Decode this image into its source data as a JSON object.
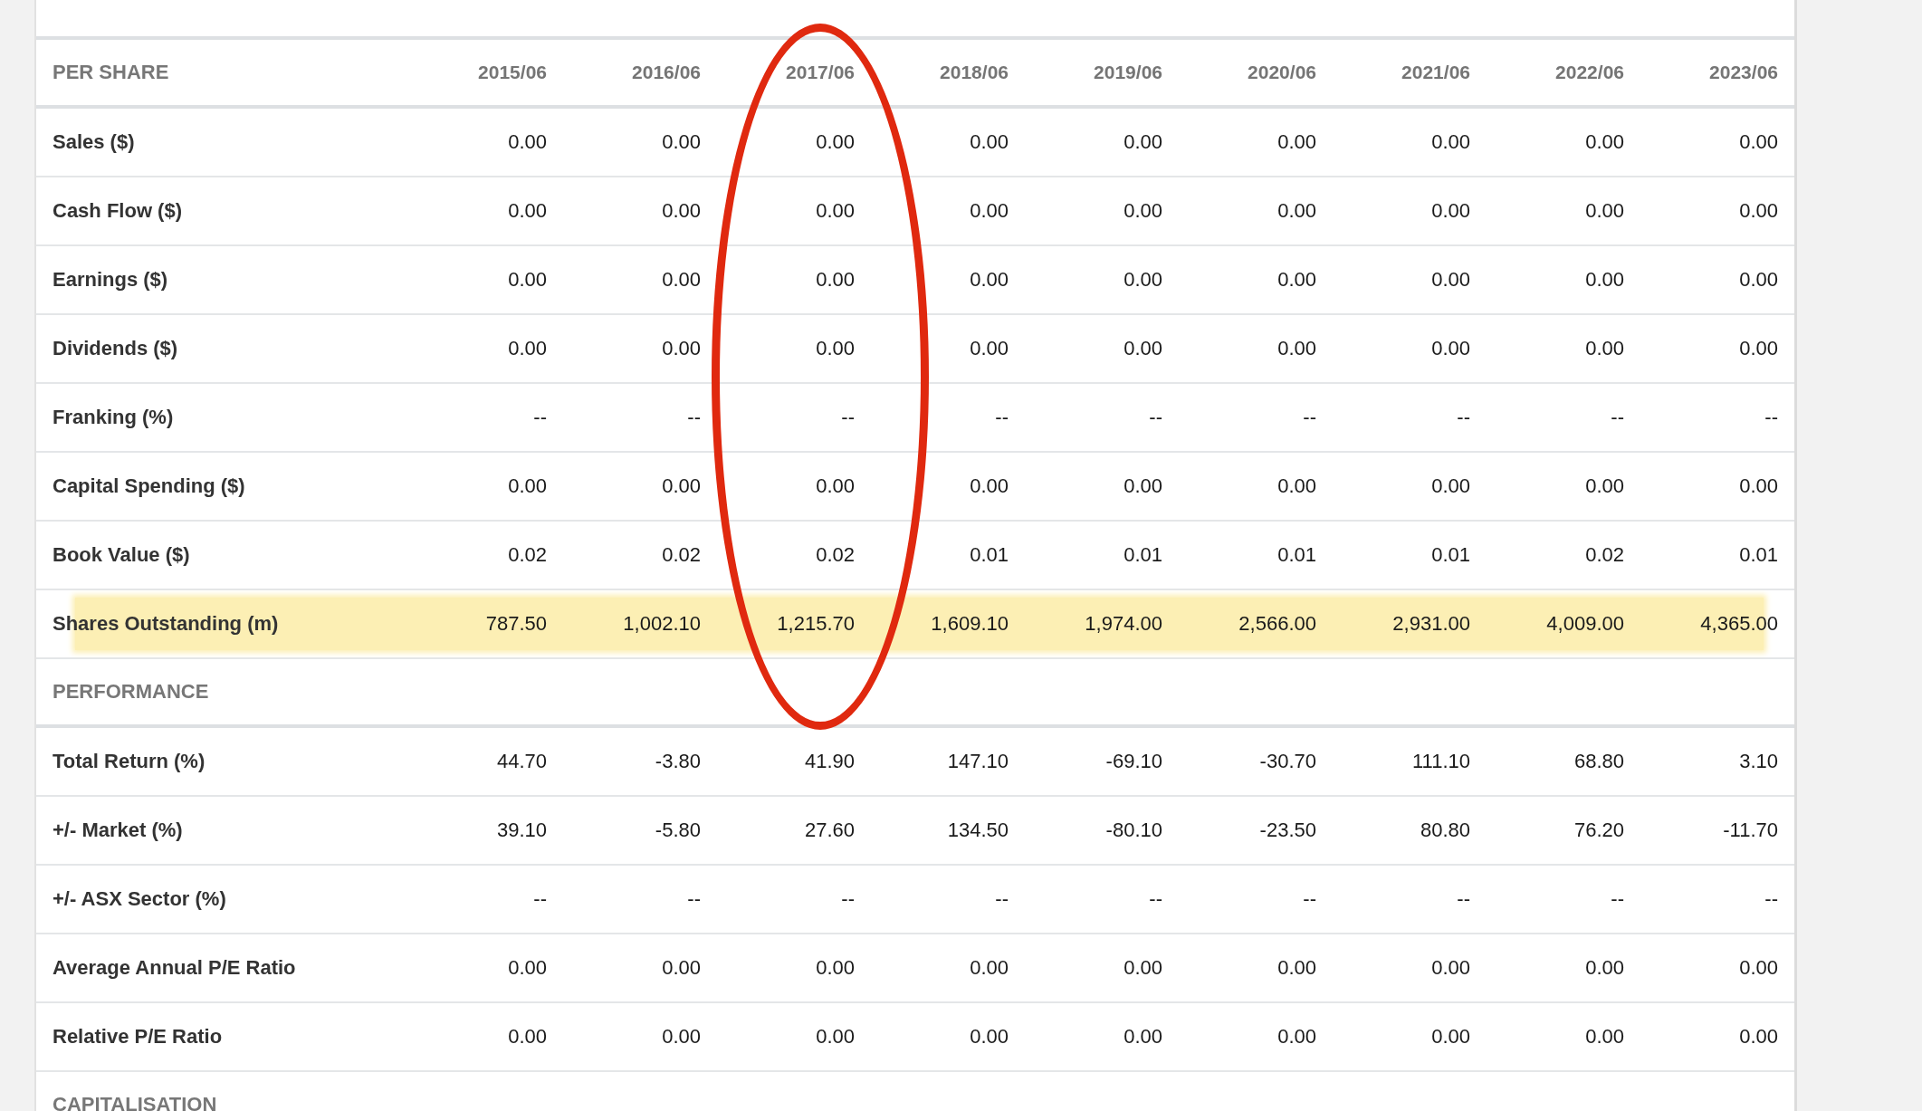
{
  "columns": [
    {
      "label": "2015/06",
      "circled": false
    },
    {
      "label": "2016/06",
      "circled": false
    },
    {
      "label": "2017/06",
      "circled": true
    },
    {
      "label": "2018/06",
      "circled": false
    },
    {
      "label": "2019/06",
      "circled": false
    },
    {
      "label": "2020/06",
      "circled": false
    },
    {
      "label": "2021/06",
      "circled": false
    },
    {
      "label": "2022/06",
      "circled": false
    },
    {
      "label": "2023/06",
      "circled": false
    }
  ],
  "sections": [
    {
      "title": "PER SHARE",
      "rows": [
        {
          "label": "Sales ($)",
          "highlighted": false,
          "values": [
            "0.00",
            "0.00",
            "0.00",
            "0.00",
            "0.00",
            "0.00",
            "0.00",
            "0.00",
            "0.00"
          ]
        },
        {
          "label": "Cash Flow ($)",
          "highlighted": false,
          "values": [
            "0.00",
            "0.00",
            "0.00",
            "0.00",
            "0.00",
            "0.00",
            "0.00",
            "0.00",
            "0.00"
          ]
        },
        {
          "label": "Earnings ($)",
          "highlighted": false,
          "values": [
            "0.00",
            "0.00",
            "0.00",
            "0.00",
            "0.00",
            "0.00",
            "0.00",
            "0.00",
            "0.00"
          ]
        },
        {
          "label": "Dividends ($)",
          "highlighted": false,
          "values": [
            "0.00",
            "0.00",
            "0.00",
            "0.00",
            "0.00",
            "0.00",
            "0.00",
            "0.00",
            "0.00"
          ]
        },
        {
          "label": "Franking (%)",
          "highlighted": false,
          "values": [
            "--",
            "--",
            "--",
            "--",
            "--",
            "--",
            "--",
            "--",
            "--"
          ]
        },
        {
          "label": "Capital Spending ($)",
          "highlighted": false,
          "values": [
            "0.00",
            "0.00",
            "0.00",
            "0.00",
            "0.00",
            "0.00",
            "0.00",
            "0.00",
            "0.00"
          ]
        },
        {
          "label": "Book Value ($)",
          "highlighted": false,
          "values": [
            "0.02",
            "0.02",
            "0.02",
            "0.01",
            "0.01",
            "0.01",
            "0.01",
            "0.02",
            "0.01"
          ]
        },
        {
          "label": "Shares Outstanding (m)",
          "highlighted": true,
          "values": [
            "787.50",
            "1,002.10",
            "1,215.70",
            "1,609.10",
            "1,974.00",
            "2,566.00",
            "2,931.00",
            "4,009.00",
            "4,365.00"
          ]
        }
      ]
    },
    {
      "title": "PERFORMANCE",
      "rows": [
        {
          "label": "Total Return (%)",
          "highlighted": false,
          "values": [
            "44.70",
            "-3.80",
            "41.90",
            "147.10",
            "-69.10",
            "-30.70",
            "111.10",
            "68.80",
            "3.10"
          ]
        },
        {
          "label": "+/- Market (%)",
          "highlighted": false,
          "values": [
            "39.10",
            "-5.80",
            "27.60",
            "134.50",
            "-80.10",
            "-23.50",
            "80.80",
            "76.20",
            "-11.70"
          ]
        },
        {
          "label": "+/- ASX Sector (%)",
          "highlighted": false,
          "values": [
            "--",
            "--",
            "--",
            "--",
            "--",
            "--",
            "--",
            "--",
            "--"
          ]
        },
        {
          "label": "Average Annual P/E Ratio",
          "highlighted": false,
          "values": [
            "0.00",
            "0.00",
            "0.00",
            "0.00",
            "0.00",
            "0.00",
            "0.00",
            "0.00",
            "0.00"
          ]
        },
        {
          "label": "Relative P/E Ratio",
          "highlighted": false,
          "values": [
            "0.00",
            "0.00",
            "0.00",
            "0.00",
            "0.00",
            "0.00",
            "0.00",
            "0.00",
            "0.00"
          ]
        }
      ]
    },
    {
      "title": "CAPITALISATION"
    }
  ]
}
